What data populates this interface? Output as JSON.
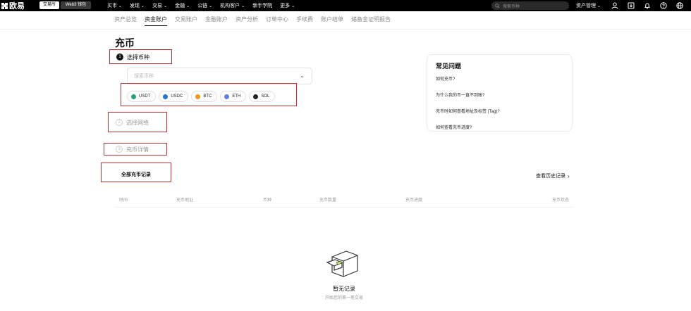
{
  "header": {
    "logo_text": "欧易",
    "pill_exchange": "交易所",
    "pill_web3": "Web3 钱包",
    "nav": [
      "买币",
      "发现",
      "交易",
      "金融",
      "公链",
      "机构客户",
      "新手学院",
      "更多"
    ],
    "search_placeholder": "搜索币种",
    "asset_mgmt": "资产管理"
  },
  "subnav": {
    "tabs": [
      "资产总览",
      "资金账户",
      "交易账户",
      "金融账户",
      "资产分析",
      "订单中心",
      "手续费",
      "账户结单",
      "储备金证明报告"
    ],
    "active_index": 1
  },
  "page": {
    "title": "充币"
  },
  "steps": {
    "step1": {
      "num": "1",
      "label": "选择币种"
    },
    "step2": {
      "num": "2",
      "label": "选择网络"
    },
    "step3": {
      "num": "3",
      "label": "充币详情"
    }
  },
  "coin_select": {
    "placeholder": "搜索币种"
  },
  "coins": [
    {
      "label": "USDT",
      "color": "#26a17b"
    },
    {
      "label": "USDC",
      "color": "#2775ca"
    },
    {
      "label": "BTC",
      "color": "#f7931a"
    },
    {
      "label": "ETH",
      "color": "#627eea"
    },
    {
      "label": "SOL",
      "color": "#222222"
    }
  ],
  "history": {
    "title": "全部充币记录",
    "link": "查看历史记录"
  },
  "table": {
    "columns": [
      "时间",
      "充币地址",
      "币种",
      "充币数量",
      "充币进度",
      "充币状态"
    ]
  },
  "empty": {
    "title": "暂无记录",
    "subtitle": "开始您的第一笔交易"
  },
  "faq": {
    "title": "常见问题",
    "questions": [
      "如何充币?",
      "为什么我的币一直不到账?",
      "充币时如何查看地址及标签 (Tag)?",
      "如何查看充币进度?"
    ]
  },
  "colors": {
    "highlight_box": "#d32b2b",
    "topbar_bg": "#000000"
  }
}
